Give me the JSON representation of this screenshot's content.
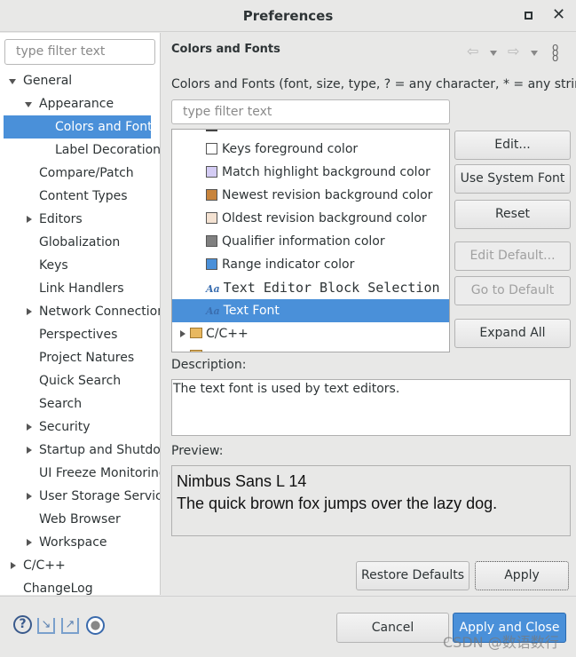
{
  "window": {
    "title": "Preferences"
  },
  "left": {
    "filter_placeholder": "type filter text",
    "tree": [
      {
        "label": "General",
        "level": 0,
        "expanded": true
      },
      {
        "label": "Appearance",
        "level": 1,
        "expanded": true
      },
      {
        "label": "Colors and Fonts",
        "level": 2,
        "selected": true
      },
      {
        "label": "Label Decorations",
        "level": 2
      },
      {
        "label": "Compare/Patch",
        "level": 1
      },
      {
        "label": "Content Types",
        "level": 1
      },
      {
        "label": "Editors",
        "level": 1,
        "collapsed": true
      },
      {
        "label": "Globalization",
        "level": 1
      },
      {
        "label": "Keys",
        "level": 1
      },
      {
        "label": "Link Handlers",
        "level": 1
      },
      {
        "label": "Network Connections",
        "level": 1,
        "collapsed": true
      },
      {
        "label": "Perspectives",
        "level": 1
      },
      {
        "label": "Project Natures",
        "level": 1
      },
      {
        "label": "Quick Search",
        "level": 1
      },
      {
        "label": "Search",
        "level": 1
      },
      {
        "label": "Security",
        "level": 1,
        "collapsed": true
      },
      {
        "label": "Startup and Shutdown",
        "level": 1,
        "collapsed": true
      },
      {
        "label": "UI Freeze Monitoring",
        "level": 1
      },
      {
        "label": "User Storage Service",
        "level": 1,
        "collapsed": true
      },
      {
        "label": "Web Browser",
        "level": 1
      },
      {
        "label": "Workspace",
        "level": 1,
        "collapsed": true
      },
      {
        "label": "C/C++",
        "level": 0,
        "collapsed": true
      },
      {
        "label": "ChangeLog",
        "level": 0
      }
    ]
  },
  "main": {
    "heading": "Colors and Fonts",
    "description": "Colors and Fonts (font, size, type, ? = any character, * = any string) :",
    "filter_placeholder": "type filter text",
    "items": [
      {
        "label": "Keys foreground color",
        "type": "color",
        "color": "#ffffff"
      },
      {
        "label": "Match highlight background color",
        "type": "color",
        "color": "#d4ccf4"
      },
      {
        "label": "Newest revision background color",
        "type": "color",
        "color": "#c8843c"
      },
      {
        "label": "Oldest revision background color",
        "type": "color",
        "color": "#f4e2d2"
      },
      {
        "label": "Qualifier information color",
        "type": "color",
        "color": "#808080"
      },
      {
        "label": "Range indicator color",
        "type": "color",
        "color": "#4a90d9"
      },
      {
        "label": "Text Editor Block Selection Font",
        "type": "font",
        "mono": true
      },
      {
        "label": "Text Font",
        "type": "font",
        "selected": true
      },
      {
        "label": "C/C++",
        "type": "category"
      }
    ],
    "buttons": {
      "edit": "Edit...",
      "use_system_font": "Use System Font",
      "reset": "Reset",
      "edit_default": "Edit Default...",
      "go_to_default": "Go to Default",
      "expand_all": "Expand All"
    },
    "description_label": "Description:",
    "description_text": "The text font is used by text editors.",
    "preview_label": "Preview:",
    "preview_line1": "Nimbus Sans L 14",
    "preview_line2": "The quick brown fox jumps over the lazy dog.",
    "restore_defaults": "Restore Defaults",
    "apply": "Apply"
  },
  "footer": {
    "cancel": "Cancel",
    "apply_and_close": "Apply and Close",
    "watermark": "CSDN @数语数行"
  },
  "colors": {
    "accent": "#4a90d9"
  }
}
